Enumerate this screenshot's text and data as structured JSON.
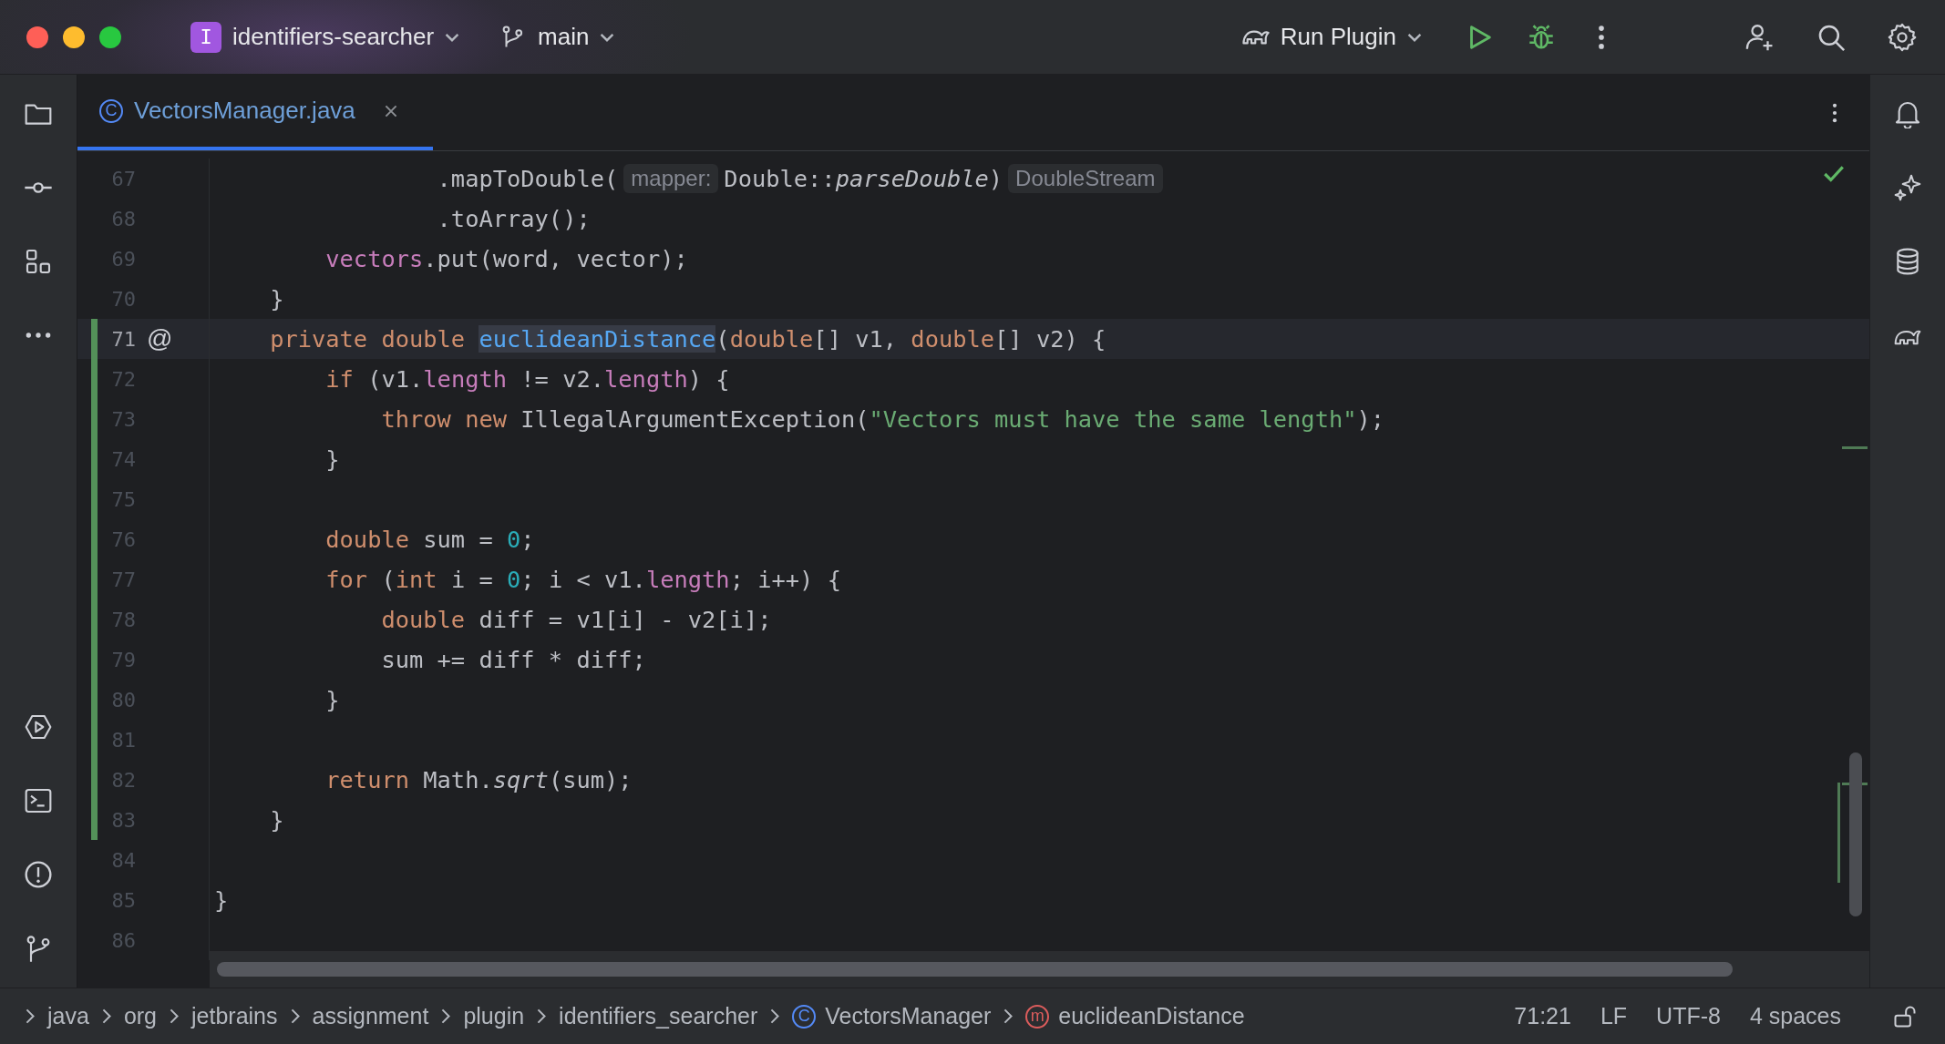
{
  "title_bar": {
    "project": {
      "badge": "I",
      "name": "identifiers-searcher"
    },
    "branch": "main",
    "run_config": "Run Plugin"
  },
  "tabs": [
    {
      "badge": "C",
      "label": "VectorsManager.java",
      "selected": true
    }
  ],
  "editor": {
    "lines": [
      {
        "number": "67",
        "changed": false,
        "current": false,
        "tokens": [
          {
            "kind": "plain",
            "text": "                .mapToDouble("
          },
          {
            "kind": "hint",
            "text": "mapper:"
          },
          {
            "kind": "plain",
            "text": "Double::"
          },
          {
            "kind": "italic",
            "text": "parseDouble"
          },
          {
            "kind": "plain",
            "text": ")"
          },
          {
            "kind": "hint",
            "text": "DoubleStream"
          }
        ]
      },
      {
        "number": "68",
        "changed": false,
        "current": false,
        "tokens": [
          {
            "kind": "plain",
            "text": "                .toArray();"
          }
        ]
      },
      {
        "number": "69",
        "changed": false,
        "current": false,
        "tokens": [
          {
            "kind": "field",
            "text": "        vectors"
          },
          {
            "kind": "plain",
            "text": ".put(word, vector);"
          }
        ]
      },
      {
        "number": "70",
        "changed": false,
        "current": false,
        "tokens": [
          {
            "kind": "plain",
            "text": "    }"
          }
        ]
      },
      {
        "number": "71",
        "changed": true,
        "current": true,
        "annotation": "@",
        "tokens": [
          {
            "kind": "keyword",
            "text": "    private"
          },
          {
            "kind": "keyword",
            "text": " double "
          },
          {
            "kind": "declaration",
            "text": "euclideanDistance"
          },
          {
            "kind": "plain",
            "text": "("
          },
          {
            "kind": "keyword",
            "text": "double"
          },
          {
            "kind": "plain",
            "text": "[] v1, "
          },
          {
            "kind": "keyword",
            "text": "double"
          },
          {
            "kind": "plain",
            "text": "[] v2) {"
          }
        ]
      },
      {
        "number": "72",
        "changed": true,
        "current": false,
        "tokens": [
          {
            "kind": "keyword",
            "text": "        if"
          },
          {
            "kind": "plain",
            "text": " (v1."
          },
          {
            "kind": "field",
            "text": "length"
          },
          {
            "kind": "plain",
            "text": " != v2."
          },
          {
            "kind": "field",
            "text": "length"
          },
          {
            "kind": "plain",
            "text": ") {"
          }
        ]
      },
      {
        "number": "73",
        "changed": true,
        "current": false,
        "tokens": [
          {
            "kind": "keyword",
            "text": "            throw"
          },
          {
            "kind": "keyword",
            "text": " new"
          },
          {
            "kind": "plain",
            "text": " IllegalArgumentException("
          },
          {
            "kind": "string",
            "text": "\"Vectors must have the same length\""
          },
          {
            "kind": "plain",
            "text": ");"
          }
        ]
      },
      {
        "number": "74",
        "changed": true,
        "current": false,
        "tokens": [
          {
            "kind": "plain",
            "text": "        }"
          }
        ]
      },
      {
        "number": "75",
        "changed": true,
        "current": false
      },
      {
        "number": "76",
        "changed": true,
        "current": false,
        "tokens": [
          {
            "kind": "keyword",
            "text": "        double"
          },
          {
            "kind": "plain",
            "text": " sum = "
          },
          {
            "kind": "number",
            "text": "0"
          },
          {
            "kind": "plain",
            "text": ";"
          }
        ]
      },
      {
        "number": "77",
        "changed": true,
        "current": false,
        "tokens": [
          {
            "kind": "keyword",
            "text": "        for"
          },
          {
            "kind": "plain",
            "text": " ("
          },
          {
            "kind": "keyword",
            "text": "int"
          },
          {
            "kind": "plain",
            "text": " i = "
          },
          {
            "kind": "number",
            "text": "0"
          },
          {
            "kind": "plain",
            "text": "; i < v1."
          },
          {
            "kind": "field",
            "text": "length"
          },
          {
            "kind": "plain",
            "text": "; i++) {"
          }
        ]
      },
      {
        "number": "78",
        "changed": true,
        "current": false,
        "tokens": [
          {
            "kind": "keyword",
            "text": "            double"
          },
          {
            "kind": "plain",
            "text": " diff = v1[i] - v2[i];"
          }
        ]
      },
      {
        "number": "79",
        "changed": true,
        "current": false,
        "tokens": [
          {
            "kind": "plain",
            "text": "            sum += diff * diff;"
          }
        ]
      },
      {
        "number": "80",
        "changed": true,
        "current": false,
        "tokens": [
          {
            "kind": "plain",
            "text": "        }"
          }
        ]
      },
      {
        "number": "81",
        "changed": true,
        "current": false
      },
      {
        "number": "82",
        "changed": true,
        "current": false,
        "tokens": [
          {
            "kind": "keyword",
            "text": "        return"
          },
          {
            "kind": "plain",
            "text": " Math."
          },
          {
            "kind": "italic",
            "text": "sqrt"
          },
          {
            "kind": "plain",
            "text": "(sum);"
          }
        ]
      },
      {
        "number": "83",
        "changed": true,
        "current": false,
        "tokens": [
          {
            "kind": "plain",
            "text": "    }"
          }
        ]
      },
      {
        "number": "84",
        "changed": false,
        "current": false
      },
      {
        "number": "85",
        "changed": false,
        "current": false,
        "tokens": [
          {
            "kind": "plain",
            "text": "}"
          }
        ]
      },
      {
        "number": "86",
        "changed": false,
        "current": false
      }
    ]
  },
  "breadcrumbs": [
    {
      "kind": "package",
      "label": "java"
    },
    {
      "kind": "package",
      "label": "org"
    },
    {
      "kind": "package",
      "label": "jetbrains"
    },
    {
      "kind": "package",
      "label": "assignment"
    },
    {
      "kind": "package",
      "label": "plugin"
    },
    {
      "kind": "package",
      "label": "identifiers_searcher"
    },
    {
      "kind": "class",
      "badge": "C",
      "label": "VectorsManager"
    },
    {
      "kind": "method",
      "badge": "m",
      "label": "euclideanDistance"
    }
  ],
  "status": {
    "position": "71:21",
    "line_separator": "LF",
    "encoding": "UTF-8",
    "indent": "4 spaces"
  }
}
